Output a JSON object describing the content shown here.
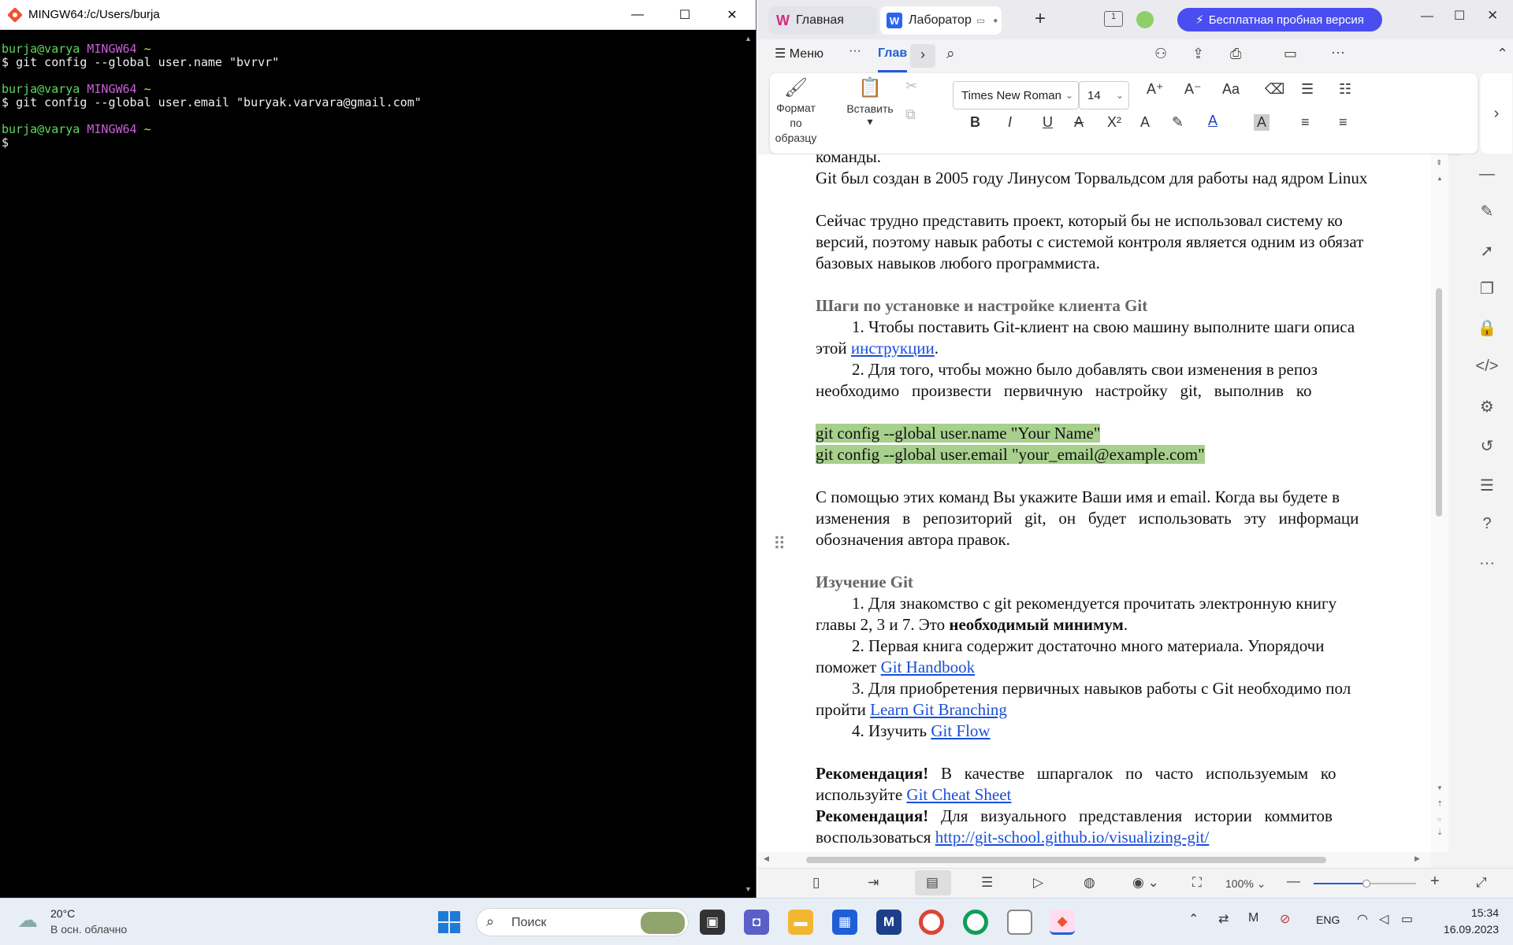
{
  "terminal": {
    "title": "MINGW64:/c/Users/burja",
    "lines": [
      {
        "user": "burja@varya",
        "host": "MINGW64",
        "dir": "~",
        "cmd": "git config --global user.name \"bvrvr\""
      },
      {
        "user": "burja@varya",
        "host": "MINGW64",
        "dir": "~",
        "cmd": "git config --global user.email \"buryak.varvara@gmail.com\""
      },
      {
        "user": "burja@varya",
        "host": "MINGW64",
        "dir": "~",
        "cmd": ""
      }
    ],
    "prompt_symbol": "$",
    "controls": {
      "minimize": "—",
      "maximize": "☐",
      "close": "✕"
    }
  },
  "wps": {
    "tabs": [
      {
        "label": "Главная"
      },
      {
        "label": "Лаборатор"
      }
    ],
    "trial_button": "Бесплатная пробная версия",
    "menu": {
      "menu_label": "Меню",
      "more": "···",
      "active_tab": "Глав"
    },
    "ribbon": {
      "format_painter": "Формат\nпо образцу",
      "format_painter_l1": "Формат",
      "format_painter_l2": "по образцу",
      "paste": "Вставить",
      "font_name": "Times New Roman",
      "font_size": "14"
    },
    "document": {
      "paragraphs": [
        {
          "text": "команды.",
          "style": "plain"
        },
        {
          "text": "Git был создан в 2005 году Линусом Торвальдсом для работы над ядром Linux",
          "style": "plain"
        },
        {
          "text": "",
          "style": "plain"
        },
        {
          "text": "Сейчас трудно представить проект, который бы не использовал систему ко",
          "style": "plain"
        },
        {
          "text": "версий, поэтому навык работы с системой контроля является одним из обязат",
          "style": "plain"
        },
        {
          "text": "базовых навыков любого программиста.",
          "style": "plain"
        },
        {
          "text": "",
          "style": "plain"
        },
        {
          "text": "Шаги по установке и настройке клиента Git",
          "style": "heading"
        },
        {
          "text": "1.   Чтобы поставить Git-клиент на свою машину выполните шаги описа",
          "style": "indent"
        },
        {
          "text": "этой ",
          "style": "plain",
          "link": "инструкции",
          "after": "."
        },
        {
          "text": "2.   Для того, чтобы можно было добавлять свои изменения в репоз",
          "style": "indent"
        },
        {
          "text": "необходимо   произвести   первичную   настройку   git,   выполнив   ко",
          "style": "plain"
        },
        {
          "text": "",
          "style": "plain"
        },
        {
          "text": "git config --global user.name \"Your Name\"",
          "style": "code"
        },
        {
          "text": "git config --global user.email \"your_email@example.com\"",
          "style": "code"
        },
        {
          "text": "",
          "style": "plain"
        },
        {
          "text": "С помощью этих команд Вы укажите Ваши имя и email. Когда вы будете в",
          "style": "plain"
        },
        {
          "text": "изменения   в   репозиторий   git,   он   будет   использовать   эту   информаци",
          "style": "plain"
        },
        {
          "text": "обозначения автора правок.",
          "style": "plain"
        },
        {
          "text": "",
          "style": "plain"
        },
        {
          "text": "Изучение Git",
          "style": "heading"
        },
        {
          "text": "1.   Для знакомство с git рекомендуется прочитать электронную книгу",
          "style": "indent"
        },
        {
          "text": "главы 2, 3 и 7. Это ",
          "style": "plain",
          "bold": "необходимый минимум",
          "after": "."
        },
        {
          "text": "2.   Первая книга содержит достаточно много материала. Упорядочи",
          "style": "indent"
        },
        {
          "text": "поможет ",
          "style": "plain",
          "link": "Git Handbook",
          "after": ""
        },
        {
          "text": "3.   Для приобретения первичных навыков работы с Git необходимо пол",
          "style": "indent"
        },
        {
          "text": "пройти ",
          "style": "plain",
          "link": "Learn Git Branching",
          "after": ""
        },
        {
          "text": "4.   Изучить ",
          "style": "indent",
          "link": "Git Flow ",
          "after": ""
        },
        {
          "text": "",
          "style": "plain"
        },
        {
          "text": "",
          "style": "plain",
          "bold": "Рекомендация!",
          "after": "   В   качестве   шпаргалок   по   часто   используемым   ко"
        },
        {
          "text": "используйте ",
          "style": "plain",
          "link": "Git Cheat Sheet",
          "after": ""
        },
        {
          "text": "",
          "style": "plain",
          "bold": "Рекомендация!",
          "after": "   Для   визуального   представления   истории   коммитов"
        },
        {
          "text": "воспользоваться ",
          "style": "plain",
          "link": "http://git-school.github.io/visualizing-git/",
          "after": ""
        }
      ]
    },
    "status": {
      "zoom": "100%"
    }
  },
  "taskbar": {
    "weather_temp": "20°C",
    "weather_desc": "В осн. облачно",
    "search_placeholder": "Поиск",
    "lang": "ENG",
    "time": "15:34",
    "date": "16.09.2023"
  },
  "colors": {
    "prompt_user": "#5fd75f",
    "prompt_host": "#c85fd7",
    "trial_button_bg": "#4a4df0",
    "code_highlight": "#a8d08d",
    "link": "#1a4fd6"
  }
}
